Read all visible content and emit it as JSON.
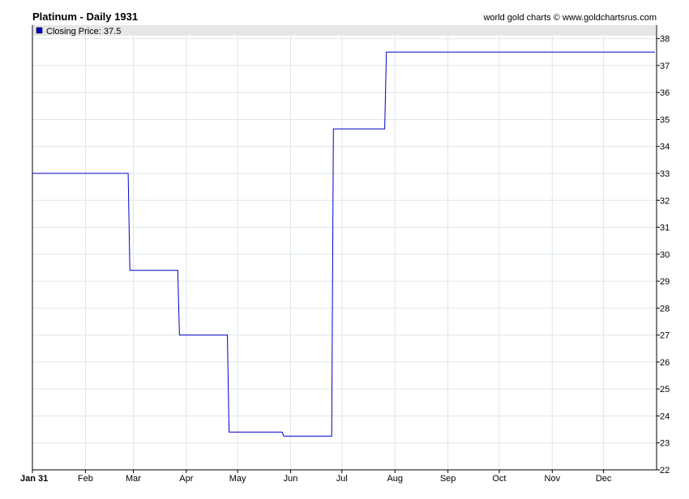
{
  "header": {
    "title": "Platinum - Daily 1931",
    "credit": "world gold charts © www.goldchartsrus.com"
  },
  "legend": {
    "label": "Closing Price: 37.5",
    "color": "#0000cc",
    "bar_color": "#e6e6e6"
  },
  "chart_data": {
    "type": "line",
    "step": true,
    "title": "Platinum - Daily 1931",
    "xlabel": "",
    "ylabel": "",
    "series": [
      {
        "name": "Closing Price",
        "color": "#0000cc",
        "points": [
          {
            "x": "1931-01-01",
            "y": 33.0
          },
          {
            "x": "1931-02-26",
            "y": 33.0
          },
          {
            "x": "1931-02-27",
            "y": 29.4
          },
          {
            "x": "1931-03-27",
            "y": 29.4
          },
          {
            "x": "1931-03-28",
            "y": 27.0
          },
          {
            "x": "1931-04-25",
            "y": 27.0
          },
          {
            "x": "1931-04-26",
            "y": 23.4
          },
          {
            "x": "1931-05-27",
            "y": 23.4
          },
          {
            "x": "1931-05-28",
            "y": 23.25
          },
          {
            "x": "1931-06-25",
            "y": 23.25
          },
          {
            "x": "1931-06-26",
            "y": 34.65
          },
          {
            "x": "1931-07-26",
            "y": 34.65
          },
          {
            "x": "1931-07-27",
            "y": 37.5
          },
          {
            "x": "1931-12-31",
            "y": 37.5
          }
        ]
      }
    ],
    "x_ticks": [
      {
        "label": "Jan 31",
        "date": "1931-01-01",
        "bold": true
      },
      {
        "label": "Feb",
        "date": "1931-02-01"
      },
      {
        "label": "Mar",
        "date": "1931-03-01"
      },
      {
        "label": "Apr",
        "date": "1931-04-01"
      },
      {
        "label": "May",
        "date": "1931-05-01"
      },
      {
        "label": "Jun",
        "date": "1931-06-01"
      },
      {
        "label": "Jul",
        "date": "1931-07-01"
      },
      {
        "label": "Aug",
        "date": "1931-08-01"
      },
      {
        "label": "Sep",
        "date": "1931-09-01"
      },
      {
        "label": "Oct",
        "date": "1931-10-01"
      },
      {
        "label": "Nov",
        "date": "1931-11-01"
      },
      {
        "label": "Dec",
        "date": "1931-12-01"
      }
    ],
    "xlim": [
      "1931-01-01",
      "1931-12-31"
    ],
    "y_ticks": [
      22,
      23,
      24,
      25,
      26,
      27,
      28,
      29,
      30,
      31,
      32,
      33,
      34,
      35,
      36,
      37,
      38
    ],
    "ylim": [
      22,
      38.5
    ],
    "grid": true,
    "legend_position": "top-left",
    "y_axis_side": "right"
  }
}
